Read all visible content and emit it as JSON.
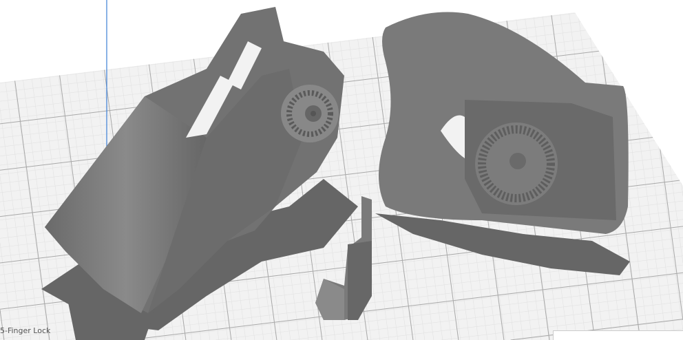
{
  "viewport": {
    "object_label": "5-Finger Lock",
    "colors": {
      "build_plate": "#f2f2f2",
      "grid_major": "#a8a8a8",
      "grid_minor": "#e2e2e2",
      "model": "#7a7a7a",
      "model_dark": "#5e5e5e",
      "shadow": "#666666",
      "axis": "#3b7fd6"
    }
  }
}
